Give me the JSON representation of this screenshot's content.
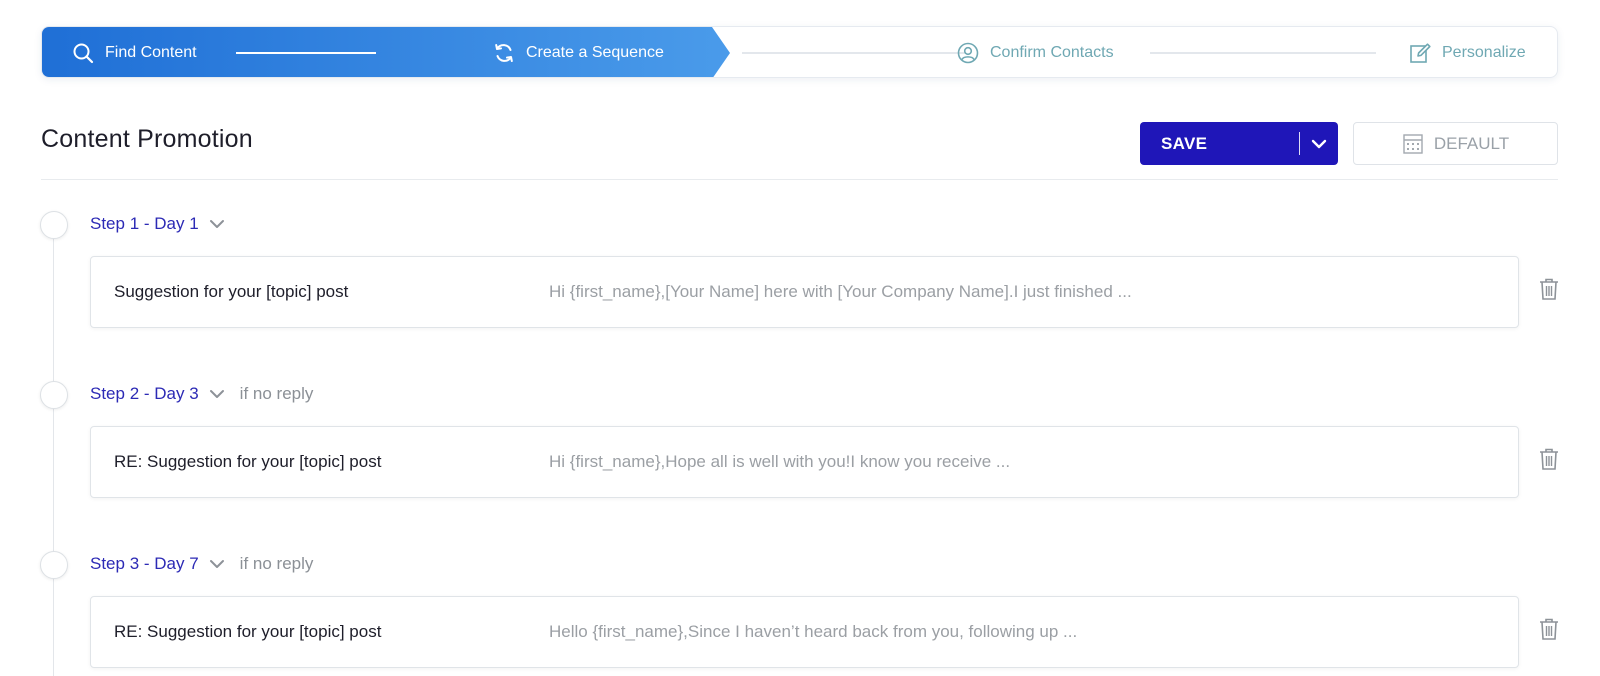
{
  "stepper": {
    "steps": [
      {
        "label": "Find Content",
        "icon": "search-icon",
        "state": "done"
      },
      {
        "label": "Create a Sequence",
        "icon": "refresh-icon",
        "state": "current"
      },
      {
        "label": "Confirm Contacts",
        "icon": "user-circle-icon",
        "state": "todo"
      },
      {
        "label": "Personalize",
        "icon": "edit-icon",
        "state": "todo"
      }
    ],
    "colors": {
      "active_start": "#1f6fd6",
      "active_end": "#4a9bea",
      "todo_text": "#6fa8b3"
    }
  },
  "header": {
    "title": "Content Promotion",
    "save_label": "SAVE",
    "default_label": "DEFAULT"
  },
  "sequence": {
    "steps": [
      {
        "label": "Step 1 - Day 1",
        "condition": "",
        "subject": "Suggestion for your [topic] post",
        "preview": "Hi {first_name},[Your Name] here with [Your Company Name].I just finished ..."
      },
      {
        "label": "Step 2 - Day 3",
        "condition": "if no reply",
        "subject": "RE: Suggestion for your [topic] post",
        "preview": "Hi {first_name},Hope all is well with you!I know you receive ..."
      },
      {
        "label": "Step 3 - Day 7",
        "condition": "if no reply",
        "subject": "RE: Suggestion for your [topic] post",
        "preview": "Hello {first_name},Since I haven’t heard back from you, following up ..."
      }
    ]
  },
  "colors": {
    "accent": "#1f16b8",
    "step_link": "#2c2ab5"
  }
}
